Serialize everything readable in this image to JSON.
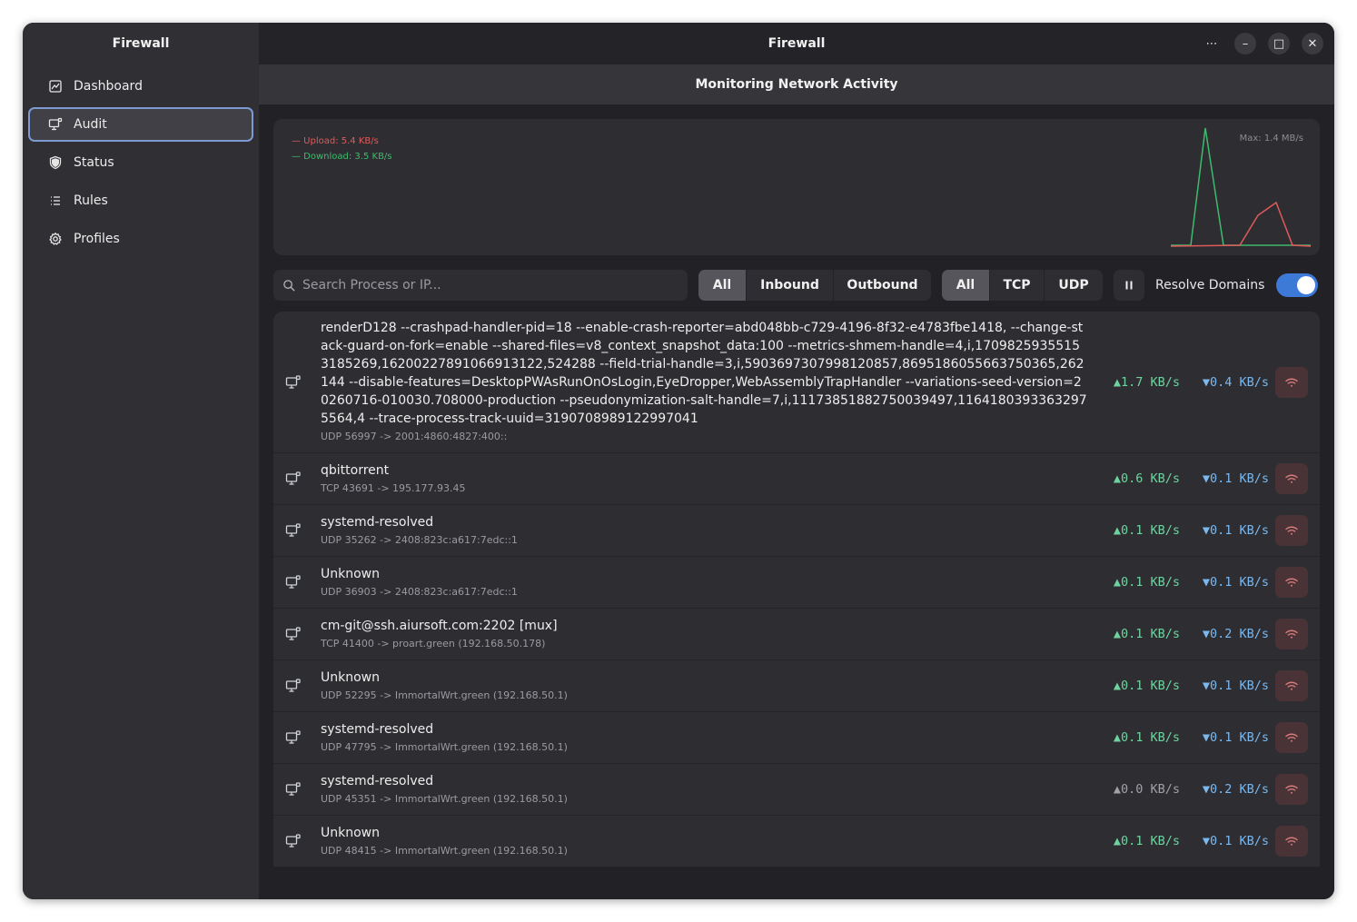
{
  "sidebar": {
    "title": "Firewall",
    "items": [
      {
        "label": "Dashboard",
        "icon": "dashboard-icon"
      },
      {
        "label": "Audit",
        "icon": "monitor-icon",
        "active": true
      },
      {
        "label": "Status",
        "icon": "shield-icon"
      },
      {
        "label": "Rules",
        "icon": "list-icon"
      },
      {
        "label": "Profiles",
        "icon": "gear-icon"
      }
    ]
  },
  "header": {
    "title": "Firewall",
    "subtitle": "Monitoring Network Activity",
    "controls": {
      "menu": "⋯",
      "minimize": "–",
      "maximize": "□",
      "close": "✕"
    }
  },
  "graph": {
    "upload_label": "— Upload: 5.4 KB/s",
    "download_label": "— Download: 3.5 KB/s",
    "max_label": "Max: 1.4 MB/s",
    "upload_color": "#e05a5a",
    "download_color": "#3dba6c"
  },
  "toolbar": {
    "search_placeholder": "Search Process or IP...",
    "direction": [
      {
        "label": "All",
        "selected": true
      },
      {
        "label": "Inbound",
        "selected": false
      },
      {
        "label": "Outbound",
        "selected": false
      }
    ],
    "protocol": [
      {
        "label": "All",
        "selected": true
      },
      {
        "label": "TCP",
        "selected": false
      },
      {
        "label": "UDP",
        "selected": false
      }
    ],
    "pause_icon": "pause-icon",
    "resolve_label": "Resolve Domains",
    "resolve_on": true
  },
  "connections": [
    {
      "process": "renderD128 --crashpad-handler-pid=18 --enable-crash-reporter=abd048bb-c729-4196-8f32-e4783fbe1418, --change-stack-guard-on-fork=enable --shared-files=v8_context_snapshot_data:100 --metrics-shmem-handle=4,i,17098259355153185269,16200227891066913122,524288 --field-trial-handle=3,i,5903697307998120857,8695186055663750365,262144 --disable-features=DesktopPWAsRunOnOsLogin,EyeDropper,WebAssemblyTrapHandler --variations-seed-version=20260716-010030.708000-production --pseudonymization-salt-handle=7,i,11173851882750039497,11641803933632975564,4 --trace-process-track-uuid=3190708989122997041",
      "conn": "UDP 56997 -> 2001:4860:4827:400::",
      "up": "▲1.7 KB/s",
      "down": "▼0.4 KB/s"
    },
    {
      "process": "qbittorrent",
      "conn": "TCP 43691 -> 195.177.93.45",
      "up": "▲0.6 KB/s",
      "down": "▼0.1 KB/s"
    },
    {
      "process": "systemd-resolved",
      "conn": "UDP 35262 -> 2408:823c:a617:7edc::1",
      "up": "▲0.1 KB/s",
      "down": "▼0.1 KB/s"
    },
    {
      "process": "Unknown",
      "conn": "UDP 36903 -> 2408:823c:a617:7edc::1",
      "up": "▲0.1 KB/s",
      "down": "▼0.1 KB/s"
    },
    {
      "process": "cm-git@ssh.aiursoft.com:2202 [mux]",
      "conn": "TCP 41400 -> proart.green (192.168.50.178)",
      "up": "▲0.1 KB/s",
      "down": "▼0.2 KB/s"
    },
    {
      "process": "Unknown",
      "conn": "UDP 52295 -> ImmortalWrt.green (192.168.50.1)",
      "up": "▲0.1 KB/s",
      "down": "▼0.1 KB/s"
    },
    {
      "process": "systemd-resolved",
      "conn": "UDP 47795 -> ImmortalWrt.green (192.168.50.1)",
      "up": "▲0.1 KB/s",
      "down": "▼0.1 KB/s"
    },
    {
      "process": "systemd-resolved",
      "conn": "UDP 45351 -> ImmortalWrt.green (192.168.50.1)",
      "up": "▲0.0 KB/s",
      "down": "▼0.2 KB/s"
    },
    {
      "process": "Unknown",
      "conn": "UDP 48415 -> ImmortalWrt.green (192.168.50.1)",
      "up": "▲0.1 KB/s",
      "down": "▼0.1 KB/s"
    }
  ]
}
